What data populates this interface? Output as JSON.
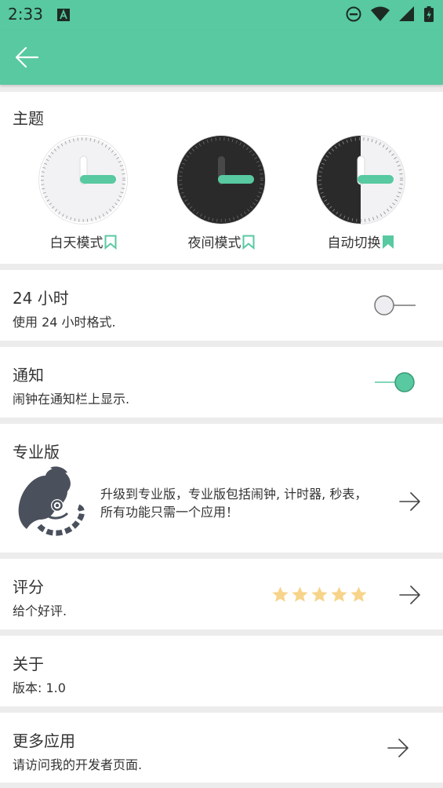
{
  "status": {
    "time": "2:33"
  },
  "theme": {
    "title": "主题",
    "options": [
      {
        "label": "白天模式",
        "selected": false
      },
      {
        "label": "夜间模式",
        "selected": false
      },
      {
        "label": "自动切换",
        "selected": true
      }
    ]
  },
  "hour24": {
    "title": "24 小时",
    "subtitle": "使用 24 小时格式.",
    "enabled": false
  },
  "notify": {
    "title": "通知",
    "subtitle": "闹钟在通知栏上显示.",
    "enabled": true
  },
  "pro": {
    "title": "专业版",
    "description": "升级到专业版，专业版包括闹钟, 计时器, 秒表，所有功能只需一个应用！"
  },
  "rating": {
    "title": "评分",
    "subtitle": "给个好评.",
    "stars": 5
  },
  "about": {
    "title": "关于",
    "subtitle": "版本: 1.0"
  },
  "more": {
    "title": "更多应用",
    "subtitle": "请访问我的开发者页面."
  },
  "colors": {
    "accent": "#58c9a0",
    "star": "#f7d48a",
    "dark": "#2a2a2a"
  }
}
